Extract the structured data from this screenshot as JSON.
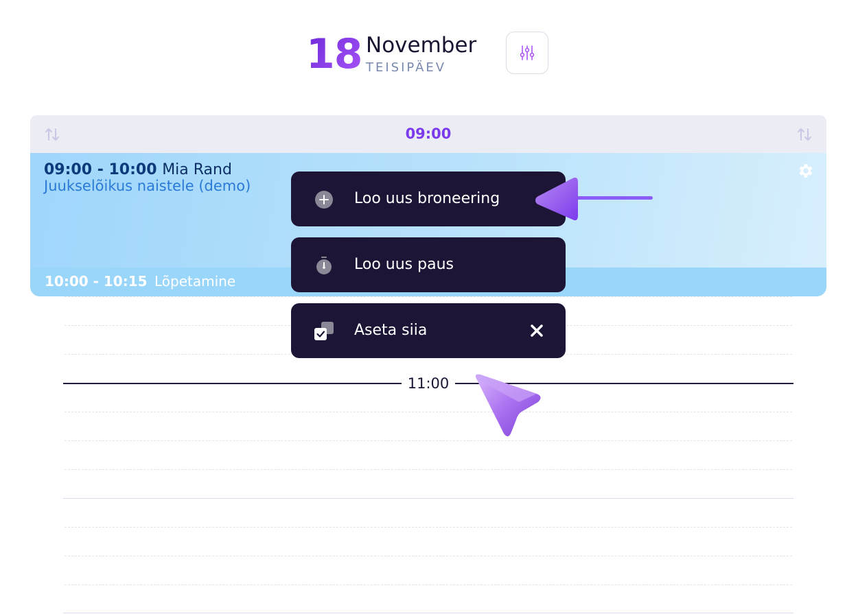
{
  "header": {
    "day": "18",
    "month": "November",
    "weekday": "TEISIPÄEV",
    "filter_icon": "sliders-icon"
  },
  "time_bar": {
    "label": "09:00",
    "sort_icon": "sort-arrows-icon"
  },
  "booking": {
    "time_range": "09:00 - 10:00",
    "client": "Mia Rand",
    "service": "Juukselõikus naistele (demo)",
    "settings_icon": "gear-icon",
    "finish_time": "10:00 - 10:15",
    "finish_label": "Lõpetamine"
  },
  "grid": {
    "hour_label": "11:00"
  },
  "context_menu": {
    "items": [
      {
        "label": "Loo uus broneering",
        "icon": "plus-circle-icon"
      },
      {
        "label": "Loo uus paus",
        "icon": "stopwatch-icon"
      },
      {
        "label": "Aseta siia",
        "icon": "paste-check-icon",
        "close_icon": "close-icon"
      }
    ]
  },
  "colors": {
    "accent": "#7c3aed",
    "menu_bg": "#1c1535",
    "booking_bg": "#b9e2fb",
    "booking_dark_text": "#0d2f66",
    "service_text": "#2a7ad6"
  }
}
